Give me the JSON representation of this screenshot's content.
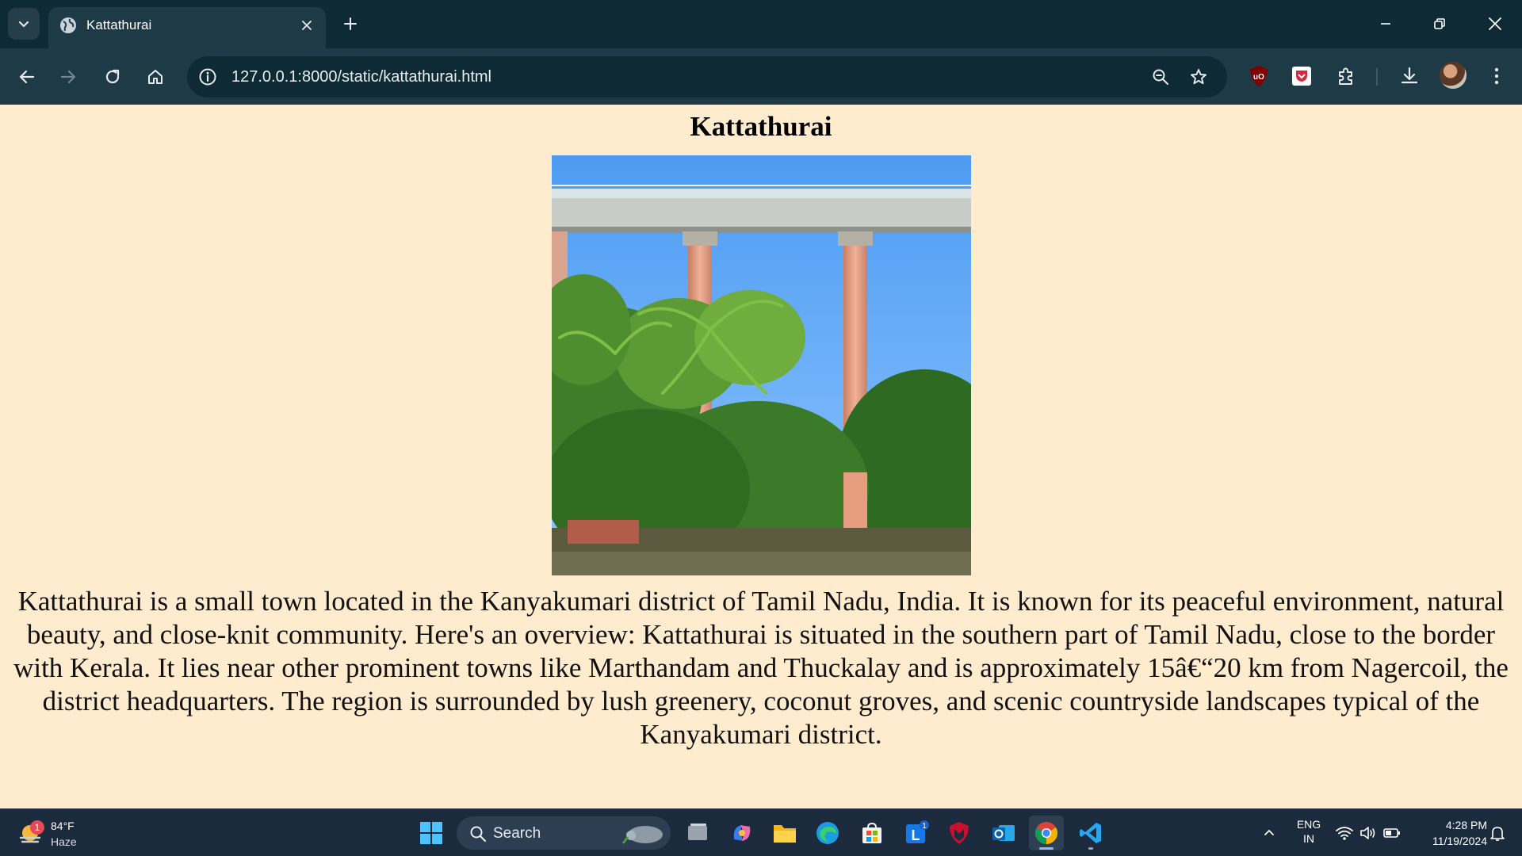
{
  "browser": {
    "tab": {
      "title": "Kattathurai"
    },
    "address_bar": {
      "url": "127.0.0.1:8000/static/kattathurai.html"
    }
  },
  "page": {
    "title": "Kattathurai",
    "description": "Kattathurai is a small town located in the Kanyakumari district of Tamil Nadu, India. It is known for its peaceful environment, natural beauty, and close-knit community. Here's an overview: Kattathurai is situated in the southern part of Tamil Nadu, close to the border with Kerala. It lies near other prominent towns like Marthandam and Thuckalay and is approximately 15â€“20 km from Nagercoil, the district headquarters. The region is surrounded by lush greenery, coconut groves, and scenic countryside landscapes typical of the Kanyakumari district."
  },
  "taskbar": {
    "weather": {
      "temperature": "84°F",
      "condition": "Haze",
      "badge": "1"
    },
    "search_label": "Search",
    "pinned_apps": [
      "task-view",
      "copilot",
      "file-explorer",
      "edge",
      "microsoft-store",
      "linkedin",
      "mcafee",
      "outlook",
      "chrome",
      "vscode"
    ],
    "app_badges": {
      "linkedin": "1"
    },
    "language": {
      "line1": "ENG",
      "line2": "IN"
    },
    "clock": {
      "time": "4:28 PM",
      "date": "11/19/2024"
    }
  },
  "colors": {
    "page_background": "#ffebcd",
    "browser_frame": "#0e2a35",
    "browser_toolbar": "#1e3a47",
    "taskbar": "#1b2b3d"
  }
}
